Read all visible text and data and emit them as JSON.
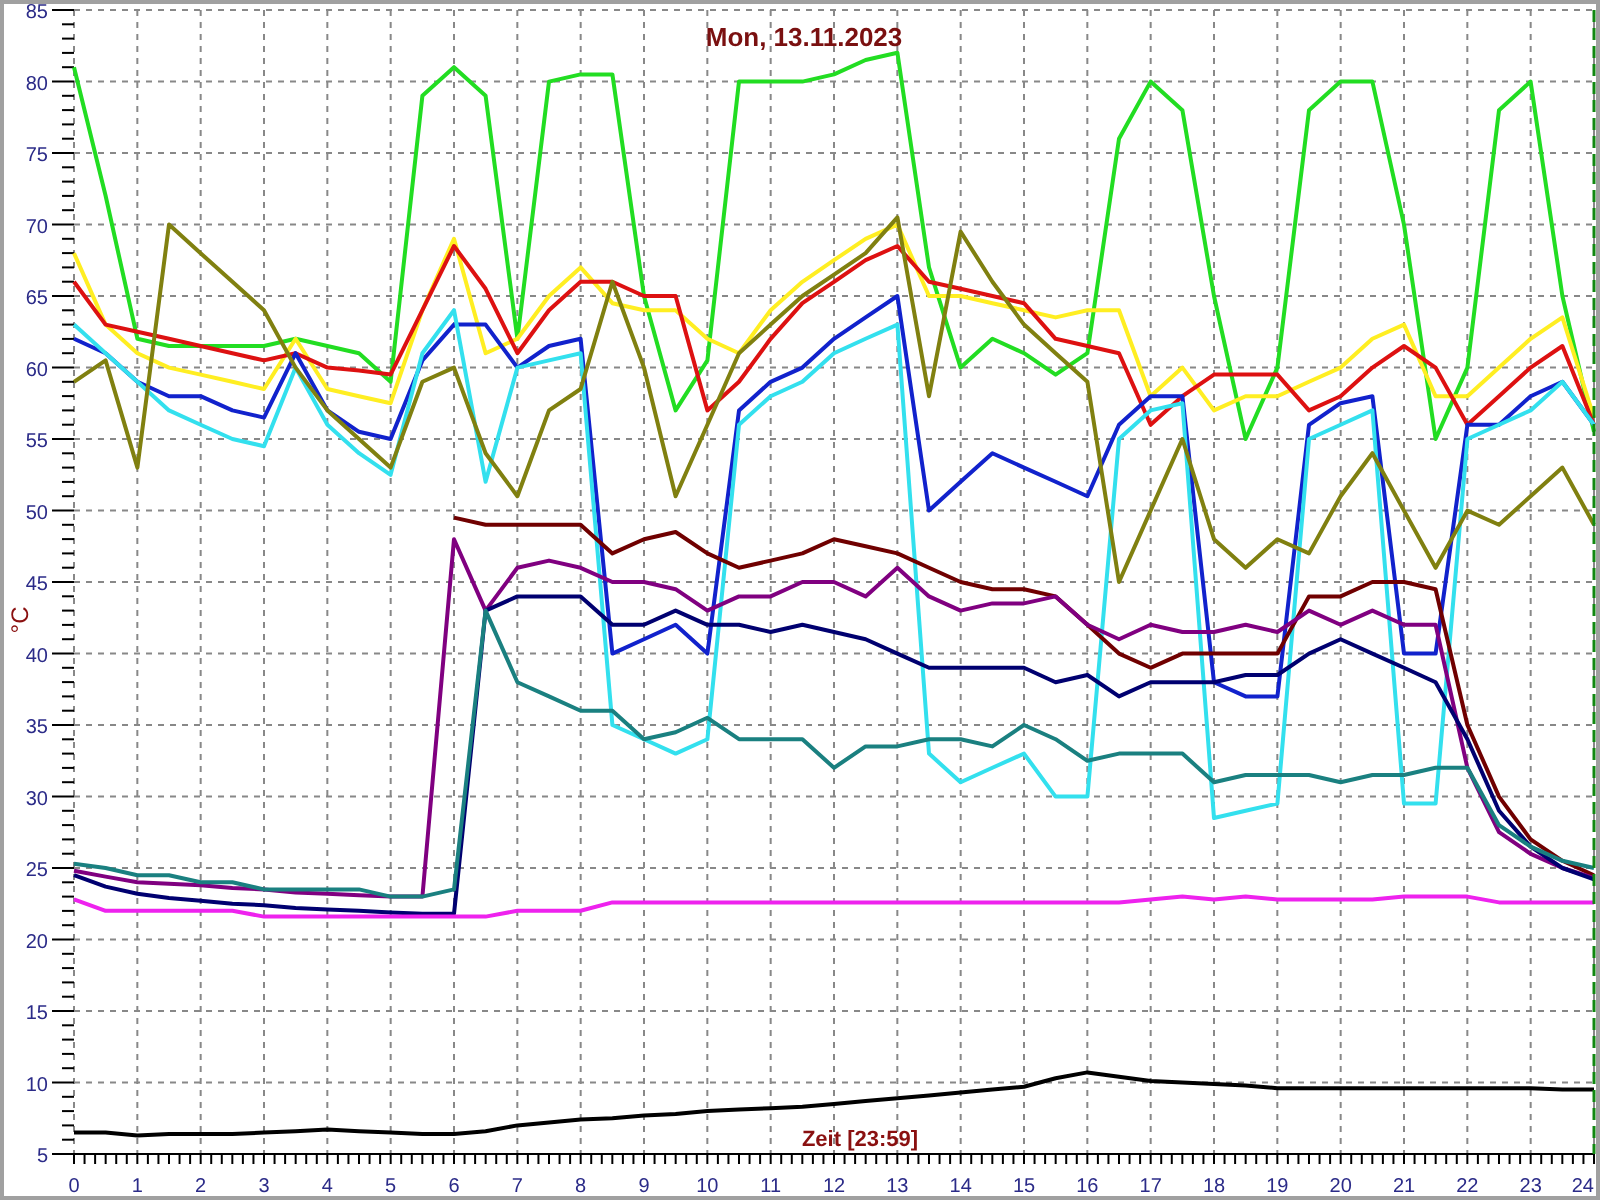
{
  "chart_data": {
    "type": "line",
    "title": "Mon, 13.11.2023",
    "xlabel": "Zeit [23:59]",
    "ylabel": "°C",
    "x": [
      0,
      0.5,
      1,
      1.5,
      2,
      2.5,
      3,
      3.5,
      4,
      4.5,
      5,
      5.5,
      6,
      6.5,
      7,
      7.5,
      8,
      8.5,
      9,
      9.5,
      10,
      10.5,
      11,
      11.5,
      12,
      12.5,
      13,
      13.5,
      14,
      14.5,
      15,
      15.5,
      16,
      16.5,
      17,
      17.5,
      18,
      18.5,
      19,
      19.5,
      20,
      20.5,
      21,
      21.5,
      22,
      22.5,
      23,
      23.5,
      24
    ],
    "series": [
      {
        "color": "#22dd22",
        "values": [
          81,
          72,
          62,
          61.5,
          61.5,
          61.5,
          61.5,
          62,
          61.5,
          61,
          59,
          79,
          81,
          79,
          62,
          80,
          80.5,
          80.5,
          65,
          57,
          60.5,
          80,
          80,
          80,
          80.5,
          81.5,
          82,
          67,
          60,
          62,
          61,
          59.5,
          61,
          76,
          80,
          78,
          65,
          55,
          60,
          78,
          80,
          80,
          70,
          55,
          60,
          78,
          80,
          65,
          55.5
        ]
      },
      {
        "color": "#ffee22",
        "values": [
          68,
          63,
          61,
          60,
          59.5,
          59,
          58.5,
          62,
          58.5,
          58,
          57.5,
          64,
          69,
          61,
          62,
          65,
          67,
          64.5,
          64,
          64,
          62,
          61,
          64,
          66,
          67.5,
          69,
          70,
          65,
          65,
          64.5,
          64,
          63.5,
          64,
          64,
          58,
          60,
          57,
          58,
          58,
          59,
          60,
          62,
          63,
          58,
          58,
          60,
          62,
          63.5,
          56.5
        ]
      },
      {
        "color": "#dd1111",
        "values": [
          66,
          63,
          62.5,
          62,
          61.5,
          61,
          60.5,
          61,
          60,
          59.8,
          59.5,
          64,
          68.5,
          65.5,
          61,
          64,
          66,
          66,
          65,
          65,
          57,
          59,
          62,
          64.5,
          66,
          67.5,
          68.5,
          66,
          65.5,
          65,
          64.5,
          62,
          61.5,
          61,
          56,
          58,
          59.5,
          59.5,
          59.5,
          57,
          58,
          60,
          61.5,
          60,
          56,
          58,
          60,
          61.5,
          56
        ]
      },
      {
        "color": "#1122cc",
        "values": [
          62,
          61,
          59,
          58,
          58,
          57,
          56.5,
          61,
          57,
          55.5,
          55,
          60.5,
          63,
          63,
          60,
          61.5,
          62,
          40,
          41,
          42,
          40,
          57,
          59,
          60,
          62,
          63.5,
          65,
          50,
          52,
          54,
          53,
          52,
          51,
          56,
          58,
          58,
          38,
          37,
          37,
          56,
          57.5,
          58,
          40,
          40,
          56,
          56,
          58,
          59,
          56
        ]
      },
      {
        "color": "#33e0ee",
        "values": [
          63,
          61,
          59,
          57,
          56,
          55,
          54.5,
          60,
          56,
          54,
          52.5,
          61,
          64,
          52,
          60,
          60.5,
          61,
          35,
          34,
          33,
          34,
          56,
          58,
          59,
          61,
          62,
          63,
          33,
          31,
          32,
          33,
          30,
          30,
          55,
          57,
          57.5,
          28.5,
          29,
          29.5,
          55,
          56,
          57,
          29.5,
          29.5,
          55,
          56,
          57,
          59,
          56
        ]
      },
      {
        "color": "#808010",
        "values": [
          59,
          60.5,
          53,
          70,
          68,
          66,
          64,
          60,
          57,
          55,
          53,
          59,
          60,
          54,
          51,
          57,
          58.5,
          66,
          60,
          51,
          56,
          61,
          63,
          65,
          66.5,
          68,
          70.5,
          58,
          69.5,
          66,
          63,
          61,
          59,
          45,
          50,
          55,
          48,
          46,
          48,
          47,
          51,
          54,
          50,
          46,
          50,
          49,
          51,
          53,
          49
        ]
      },
      {
        "color": "#700000",
        "values": [
          null,
          null,
          null,
          null,
          null,
          null,
          null,
          null,
          null,
          null,
          null,
          null,
          49.5,
          49,
          49,
          49,
          49,
          47,
          48,
          48.5,
          47,
          46,
          46.5,
          47,
          48,
          47.5,
          47,
          46,
          45,
          44.5,
          44.5,
          44,
          42,
          40,
          39,
          40,
          40,
          40,
          40,
          44,
          44,
          45,
          45,
          44.5,
          35,
          30,
          27,
          25.5,
          24.5
        ]
      },
      {
        "color": "#800080",
        "values": [
          24.8,
          24.4,
          24,
          23.9,
          23.8,
          23.6,
          23.5,
          23.3,
          23.2,
          23.1,
          23,
          23,
          48,
          43,
          46,
          46.5,
          46,
          45,
          45,
          44.5,
          43,
          44,
          44,
          45,
          45,
          44,
          46,
          44,
          43,
          43.5,
          43.5,
          44,
          42,
          41,
          42,
          41.5,
          41.5,
          42,
          41.5,
          43,
          42,
          43,
          42,
          42,
          32,
          27.5,
          26,
          25,
          24.3
        ]
      },
      {
        "color": "#000070",
        "values": [
          24.5,
          23.7,
          23.2,
          22.9,
          22.7,
          22.5,
          22.4,
          22.2,
          22.1,
          22,
          21.9,
          21.8,
          21.8,
          43,
          44,
          44,
          44,
          42,
          42,
          43,
          42,
          42,
          41.5,
          42,
          41.5,
          41,
          40,
          39,
          39,
          39,
          39,
          38,
          38.5,
          37,
          38,
          38,
          38,
          38.5,
          38.5,
          40,
          41,
          40,
          39,
          38,
          34,
          29,
          26.5,
          25,
          24.2
        ]
      },
      {
        "color": "#1a8080",
        "values": [
          25.3,
          25,
          24.5,
          24.5,
          24,
          24,
          23.5,
          23.5,
          23.5,
          23.5,
          23,
          23,
          23.5,
          43,
          38,
          37,
          36,
          36,
          34,
          34.5,
          35.5,
          34,
          34,
          34,
          32,
          33.5,
          33.5,
          34,
          34,
          33.5,
          35,
          34,
          32.5,
          33,
          33,
          33,
          31,
          31.5,
          31.5,
          31.5,
          31,
          31.5,
          31.5,
          32,
          32,
          28,
          26.5,
          25.5,
          25
        ]
      },
      {
        "color": "#ee22ee",
        "values": [
          22.8,
          22,
          22,
          22,
          22,
          22,
          21.6,
          21.6,
          21.6,
          21.6,
          21.6,
          21.6,
          21.6,
          21.6,
          22,
          22,
          22,
          22.6,
          22.6,
          22.6,
          22.6,
          22.6,
          22.6,
          22.6,
          22.6,
          22.6,
          22.6,
          22.6,
          22.6,
          22.6,
          22.6,
          22.6,
          22.6,
          22.6,
          22.8,
          23,
          22.8,
          23,
          22.8,
          22.8,
          22.8,
          22.8,
          23,
          23,
          23,
          22.6,
          22.6,
          22.6,
          22.6
        ]
      },
      {
        "color": "#000000",
        "values": [
          6.5,
          6.5,
          6.3,
          6.4,
          6.4,
          6.4,
          6.5,
          6.6,
          6.7,
          6.6,
          6.5,
          6.4,
          6.4,
          6.6,
          7,
          7.2,
          7.4,
          7.5,
          7.7,
          7.8,
          8,
          8.1,
          8.2,
          8.3,
          8.5,
          8.7,
          8.9,
          9.1,
          9.3,
          9.5,
          9.7,
          10.3,
          10.7,
          10.4,
          10.1,
          10,
          9.9,
          9.8,
          9.6,
          9.6,
          9.6,
          9.6,
          9.6,
          9.6,
          9.6,
          9.6,
          9.6,
          9.5,
          9.5
        ]
      }
    ],
    "xlim": [
      0,
      24
    ],
    "ylim": [
      5,
      85
    ],
    "xticks": [
      0,
      1,
      2,
      3,
      4,
      5,
      6,
      7,
      8,
      9,
      10,
      11,
      12,
      13,
      14,
      15,
      16,
      17,
      18,
      19,
      20,
      21,
      22,
      23,
      24
    ],
    "yticks": [
      5,
      10,
      15,
      20,
      25,
      30,
      35,
      40,
      45,
      50,
      55,
      60,
      65,
      70,
      75,
      80,
      85
    ],
    "grid": true
  }
}
